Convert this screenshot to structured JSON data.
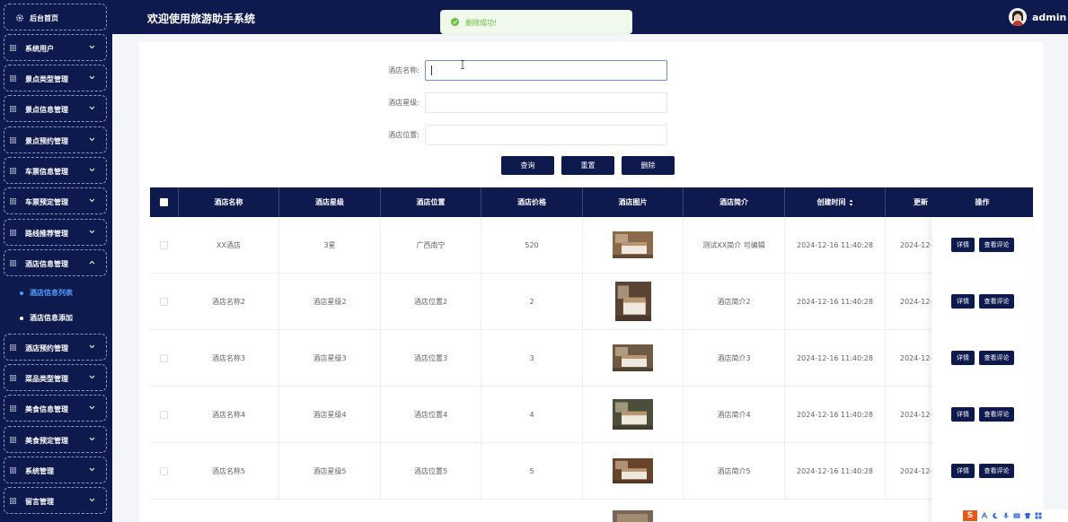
{
  "header": {
    "title": "欢迎使用旅游助手系统",
    "user": "admin"
  },
  "toast": {
    "message": "删除成功!"
  },
  "sidebar": {
    "home": "后台首页",
    "items": [
      {
        "label": "系统用户",
        "expanded": false
      },
      {
        "label": "景点类型管理",
        "expanded": false
      },
      {
        "label": "景点信息管理",
        "expanded": false
      },
      {
        "label": "景点预约管理",
        "expanded": false
      },
      {
        "label": "车票信息管理",
        "expanded": false
      },
      {
        "label": "车票预定管理",
        "expanded": false
      },
      {
        "label": "路线推荐管理",
        "expanded": false
      },
      {
        "label": "酒店信息管理",
        "expanded": true
      },
      {
        "label": "酒店预约管理",
        "expanded": false
      },
      {
        "label": "菜品类型管理",
        "expanded": false
      },
      {
        "label": "美食信息管理",
        "expanded": false
      },
      {
        "label": "美食预定管理",
        "expanded": false
      },
      {
        "label": "系统管理",
        "expanded": false
      },
      {
        "label": "留言管理",
        "expanded": false
      }
    ],
    "sub_items": [
      {
        "label": "酒店信息列表",
        "active": true
      },
      {
        "label": "酒店信息添加",
        "active": false
      }
    ]
  },
  "search": {
    "name_label": "酒店名称:",
    "name_value": "",
    "level_label": "酒店星级:",
    "level_value": "",
    "location_label": "酒店位置:",
    "location_value": "",
    "query_button": "查询",
    "reset_button": "重置",
    "delete_button": "删除"
  },
  "table": {
    "columns": [
      "酒店名称",
      "酒店星级",
      "酒店位置",
      "酒店价格",
      "酒店图片",
      "酒店简介",
      "创建时间",
      "更新",
      "操作"
    ],
    "rows": [
      {
        "name": "XX酒店",
        "level": "3星",
        "location": "广西南宁",
        "price": "520",
        "intro": "测试XX简介 可编辑",
        "created": "2024-12-16 11:40:28",
        "updated": "2024-12-",
        "photo_color": "#8a6a4a"
      },
      {
        "name": "酒店名称2",
        "level": "酒店星级2",
        "location": "酒店位置2",
        "price": "2",
        "intro": "酒店简介2",
        "created": "2024-12-16 11:40:28",
        "updated": "2024-12-",
        "photo_color": "#5a4436"
      },
      {
        "name": "酒店名称3",
        "level": "酒店星级3",
        "location": "酒店位置3",
        "price": "3",
        "intro": "酒店简介3",
        "created": "2024-12-16 11:40:28",
        "updated": "2024-12-",
        "photo_color": "#6e5a44"
      },
      {
        "name": "酒店名称4",
        "level": "酒店星级4",
        "location": "酒店位置4",
        "price": "4",
        "intro": "酒店简介4",
        "created": "2024-12-16 11:40:28",
        "updated": "2024-12-",
        "photo_color": "#4a4e3a"
      },
      {
        "name": "酒店名称5",
        "level": "酒店星级5",
        "location": "酒店位置5",
        "price": "5",
        "intro": "酒店简介5",
        "created": "2024-12-16 11:40:28",
        "updated": "2024-12-",
        "photo_color": "#6a4428"
      }
    ],
    "detail_button": "详情",
    "comments_button": "查看评论"
  },
  "tray": {
    "logo": "S"
  },
  "colors": {
    "navy": "#0e1a4d",
    "success": "#67c23a",
    "active_sub": "#4ea1ff"
  }
}
